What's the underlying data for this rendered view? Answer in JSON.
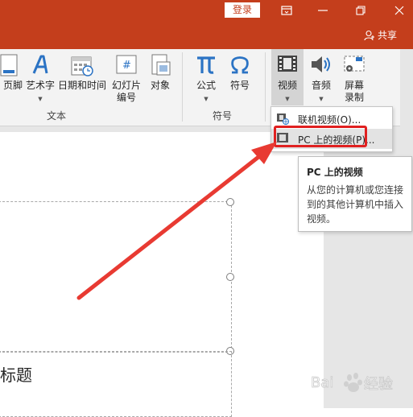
{
  "titlebar": {
    "login_label": "登录",
    "colors": {
      "accent": "#c43e1c"
    }
  },
  "tabrow": {
    "share_label": "共享"
  },
  "ribbon": {
    "buttons": [
      {
        "name": "header-footer",
        "label": "页脚"
      },
      {
        "name": "wordart",
        "label": "艺术字"
      },
      {
        "name": "date-time",
        "label": "日期和时间"
      },
      {
        "name": "slide-number",
        "label_line1": "幻灯片",
        "label_line2": "编号"
      },
      {
        "name": "object",
        "label": "对象"
      },
      {
        "name": "equation",
        "label": "公式"
      },
      {
        "name": "symbol",
        "label": "符号"
      },
      {
        "name": "video",
        "label": "视频"
      },
      {
        "name": "audio",
        "label": "音频"
      },
      {
        "name": "screen-recording",
        "label_line1": "屏幕",
        "label_line2": "录制"
      }
    ],
    "groups": {
      "text": "文本",
      "symbols": "符号"
    }
  },
  "dropdown": {
    "items": [
      {
        "label": "联机视频(O)..."
      },
      {
        "label": "PC 上的视频(P)..."
      }
    ]
  },
  "tooltip": {
    "title": "PC 上的视频",
    "lines": [
      "从您的计算机或您连接",
      "到的其他计算机中插入",
      "视频。"
    ]
  },
  "slide": {
    "subtitle_fragment": "标题"
  },
  "watermark": {
    "text": "经验",
    "brand": "Bai"
  }
}
